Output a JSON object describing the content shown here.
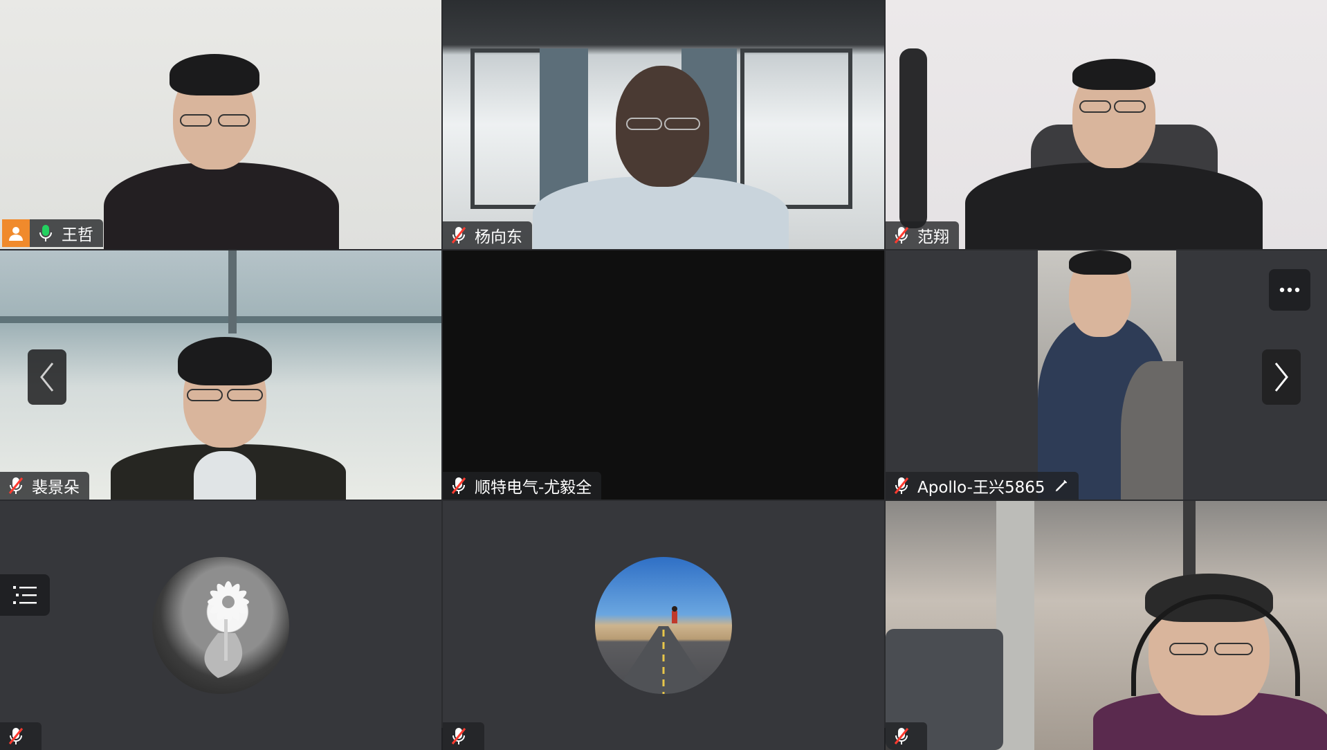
{
  "participants": [
    {
      "name": "王哲",
      "muted": false,
      "host": true,
      "active_speaker": true
    },
    {
      "name": "杨向东",
      "muted": true
    },
    {
      "name": "范翔",
      "muted": true
    },
    {
      "name": "裴景朵",
      "muted": true
    },
    {
      "name": "顺特电气-尤毅全",
      "muted": true
    },
    {
      "name": "Apollo-王兴5865",
      "muted": true,
      "editable": true
    },
    {
      "name": "",
      "muted": true
    },
    {
      "name": "",
      "muted": true
    },
    {
      "name": "",
      "muted": true
    }
  ],
  "colors": {
    "active_border": "#1fbf56",
    "host_badge": "#f08a2c",
    "mic_on": "#23d160",
    "mic_muted": "#ff3b30"
  },
  "icons": {
    "host": "person-icon",
    "mic_on": "microphone-icon",
    "mic_muted": "microphone-muted-icon",
    "prev": "chevron-left-icon",
    "next": "chevron-right-icon",
    "more": "more-dots-icon",
    "list": "list-icon",
    "edit": "pencil-icon"
  }
}
